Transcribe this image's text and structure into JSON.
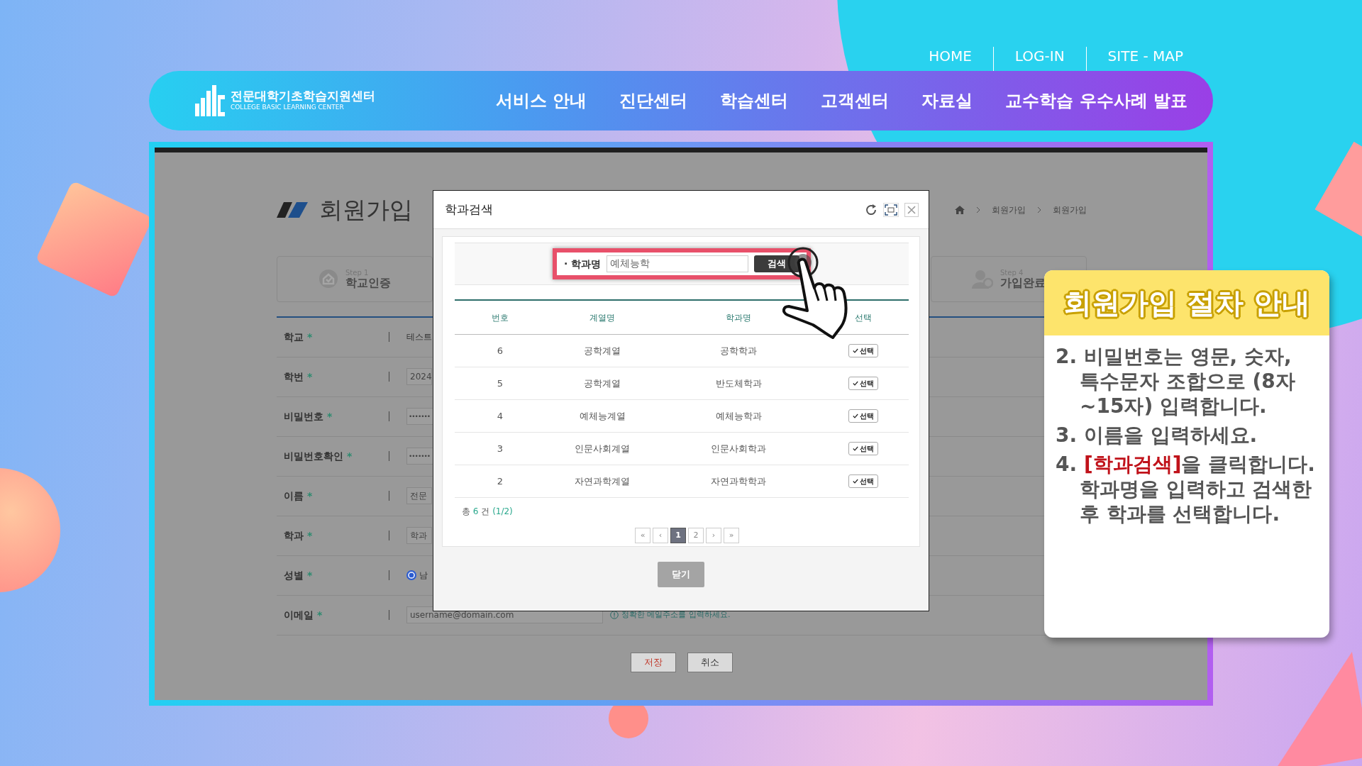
{
  "top_links": [
    {
      "label": "HOME"
    },
    {
      "label": "LOG-IN"
    },
    {
      "label": "SITE - MAP"
    }
  ],
  "logo": {
    "title": "전문대학기초학습지원센터",
    "subtitle": "COLLEGE BASIC LEARNING CENTER"
  },
  "nav": [
    {
      "label": "서비스 안내"
    },
    {
      "label": "진단센터"
    },
    {
      "label": "학습센터"
    },
    {
      "label": "고객센터"
    },
    {
      "label": "자료실"
    },
    {
      "label": "교수학습 우수사례 발표"
    }
  ],
  "page": {
    "title": "회원가입",
    "breadcrumb": [
      "회원가입",
      "회원가입"
    ],
    "steps": [
      {
        "step": "Step 1",
        "label": "학교인증",
        "kind": "school"
      },
      {
        "step": "Step 4",
        "label": "가입완료",
        "kind": "done"
      }
    ],
    "form": [
      {
        "label": "학교",
        "required_mark": "*",
        "kind": "text",
        "value": "테스트"
      },
      {
        "label": "학번",
        "required_mark": "*",
        "kind": "input",
        "value": "2024"
      },
      {
        "label": "비밀번호",
        "required_mark": "*",
        "kind": "input",
        "value": "•••••••"
      },
      {
        "label": "비밀번호확인",
        "required_mark": "*",
        "kind": "input",
        "value": "•••••••"
      },
      {
        "label": "이름",
        "required_mark": "*",
        "kind": "input",
        "value": "전문"
      },
      {
        "label": "학과",
        "required_mark": "*",
        "kind": "input",
        "value": "학과"
      },
      {
        "label": "성별",
        "required_mark": "*",
        "kind": "radio",
        "option": "남",
        "checked": true
      },
      {
        "label": "이메일",
        "required_mark": "*",
        "kind": "email",
        "value": "username@domain.com",
        "hint": "정확한 메일주소를 입력하세요."
      }
    ],
    "buttons": [
      {
        "label": "저장",
        "kind": "primary"
      },
      {
        "label": "취소",
        "kind": "default"
      }
    ]
  },
  "modal": {
    "title": "학과검색",
    "search": {
      "label": "· 학과명",
      "value": "예체능학",
      "button": "검색"
    },
    "columns": [
      "번호",
      "계열명",
      "학과명",
      "선택"
    ],
    "rows": [
      {
        "no": "6",
        "group": "공학계열",
        "dept": "공학학과",
        "action": "선택"
      },
      {
        "no": "5",
        "group": "공학계열",
        "dept": "반도체학과",
        "action": "선택"
      },
      {
        "no": "4",
        "group": "예체능계열",
        "dept": "예체능학과",
        "action": "선택"
      },
      {
        "no": "3",
        "group": "인문사회계열",
        "dept": "인문사회학과",
        "action": "선택"
      },
      {
        "no": "2",
        "group": "자연과학계열",
        "dept": "자연과학학과",
        "action": "선택"
      }
    ],
    "total": {
      "prefix": "총",
      "count": "6",
      "unit": "건",
      "page": "(1/2)"
    },
    "pagination": [
      {
        "label": "«",
        "selected": false
      },
      {
        "label": "‹",
        "selected": false
      },
      {
        "label": "1",
        "selected": true
      },
      {
        "label": "2",
        "selected": false
      },
      {
        "label": "›",
        "selected": false
      },
      {
        "label": "»",
        "selected": false
      }
    ],
    "close_button": "닫기"
  },
  "guide": {
    "title": "회원가입 절차 안내",
    "items": [
      {
        "number": "2.",
        "text": "비밀번호는 영문, 숫자, 특수문자 조합으로 (8자~15자) 입력합니다."
      },
      {
        "number": "3.",
        "text": "이름을 입력하세요."
      },
      {
        "number": "4.",
        "highlight": "[학과검색]",
        "text": "을 클릭합니다. 학과명을 입력하고 검색한 후 학과를 선택합니다."
      }
    ]
  }
}
